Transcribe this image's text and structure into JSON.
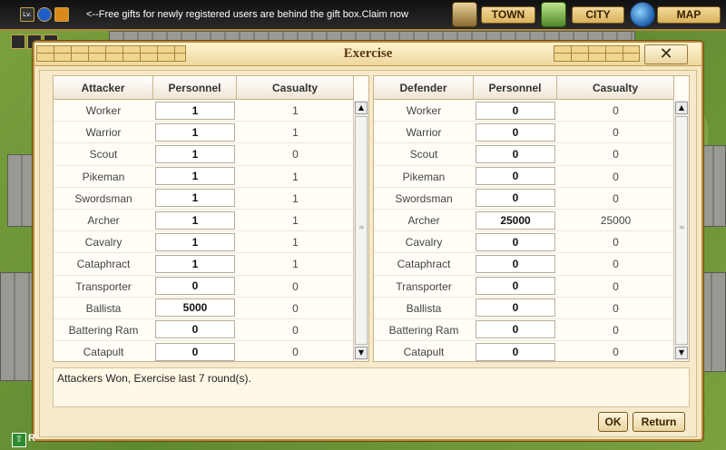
{
  "topbar": {
    "level_icon": "Lv.",
    "ticker": "<--Free gifts for newly registered users are behind the gift box.Claim now",
    "town_label": "TOWN",
    "city_label": "CITY",
    "map_label": "MAP"
  },
  "dialog": {
    "title": "Exercise",
    "close_glyph": "✕",
    "result": "Attackers Won, Exercise last 7 round(s).",
    "ok_label": "OK",
    "return_label": "Return"
  },
  "attacker": {
    "headers": [
      "Attacker",
      "Personnel",
      "Casualty"
    ],
    "rows": [
      {
        "unit": "Worker",
        "personnel": "1",
        "casualty": "1"
      },
      {
        "unit": "Warrior",
        "personnel": "1",
        "casualty": "1"
      },
      {
        "unit": "Scout",
        "personnel": "1",
        "casualty": "0"
      },
      {
        "unit": "Pikeman",
        "personnel": "1",
        "casualty": "1"
      },
      {
        "unit": "Swordsman",
        "personnel": "1",
        "casualty": "1"
      },
      {
        "unit": "Archer",
        "personnel": "1",
        "casualty": "1"
      },
      {
        "unit": "Cavalry",
        "personnel": "1",
        "casualty": "1"
      },
      {
        "unit": "Cataphract",
        "personnel": "1",
        "casualty": "1"
      },
      {
        "unit": "Transporter",
        "personnel": "0",
        "casualty": "0"
      },
      {
        "unit": "Ballista",
        "personnel": "5000",
        "casualty": "0"
      },
      {
        "unit": "Battering Ram",
        "personnel": "0",
        "casualty": "0"
      },
      {
        "unit": "Catapult",
        "personnel": "0",
        "casualty": "0"
      }
    ]
  },
  "defender": {
    "headers": [
      "Defender",
      "Personnel",
      "Casualty"
    ],
    "rows": [
      {
        "unit": "Worker",
        "personnel": "0",
        "casualty": "0"
      },
      {
        "unit": "Warrior",
        "personnel": "0",
        "casualty": "0"
      },
      {
        "unit": "Scout",
        "personnel": "0",
        "casualty": "0"
      },
      {
        "unit": "Pikeman",
        "personnel": "0",
        "casualty": "0"
      },
      {
        "unit": "Swordsman",
        "personnel": "0",
        "casualty": "0"
      },
      {
        "unit": "Archer",
        "personnel": "25000",
        "casualty": "25000"
      },
      {
        "unit": "Cavalry",
        "personnel": "0",
        "casualty": "0"
      },
      {
        "unit": "Cataphract",
        "personnel": "0",
        "casualty": "0"
      },
      {
        "unit": "Transporter",
        "personnel": "0",
        "casualty": "0"
      },
      {
        "unit": "Ballista",
        "personnel": "0",
        "casualty": "0"
      },
      {
        "unit": "Battering Ram",
        "personnel": "0",
        "casualty": "0"
      },
      {
        "unit": "Catapult",
        "personnel": "0",
        "casualty": "0"
      }
    ]
  },
  "scrollbar": {
    "up_glyph": "▲",
    "down_glyph": "▼",
    "grip_glyph": "≡"
  },
  "bottom_left": {
    "label": "R"
  },
  "colors": {
    "dialog_bg": "#f5e7c4",
    "border": "#b78a3c",
    "title": "#5b3a12"
  }
}
